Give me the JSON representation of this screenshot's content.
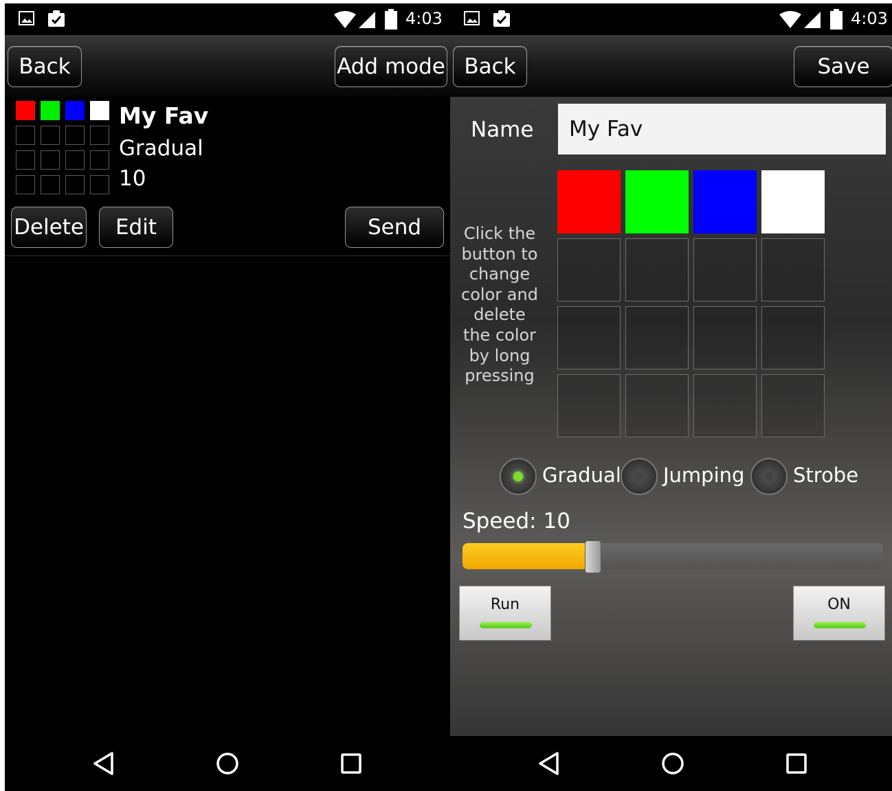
{
  "status_bar": {
    "time": "4:03"
  },
  "left_screen": {
    "action_bar": {
      "back_label": "Back",
      "add_mode_label": "Add mode"
    },
    "mode_item": {
      "name": "My Fav",
      "mode": "Gradual",
      "speed": "10",
      "colors": [
        "#ff0000",
        "#00ee00",
        "#0000ff",
        "#ffffff"
      ],
      "delete_label": "Delete",
      "edit_label": "Edit",
      "send_label": "Send"
    }
  },
  "right_screen": {
    "action_bar": {
      "back_label": "Back",
      "save_label": "Save"
    },
    "name_label": "Name",
    "name_value": "My Fav",
    "hint": "Click the button to change color and delete the color by long pressing",
    "colors": [
      "#ff0000",
      "#00ff00",
      "#0000ff",
      "#ffffff"
    ],
    "modes": [
      "Gradual",
      "Jumping",
      "Strobe"
    ],
    "selected_mode": "Gradual",
    "speed_label": "Speed: 10",
    "speed_fraction": 0.31,
    "run_label": "Run",
    "on_label": "ON",
    "accent_color": "#f5b800"
  }
}
